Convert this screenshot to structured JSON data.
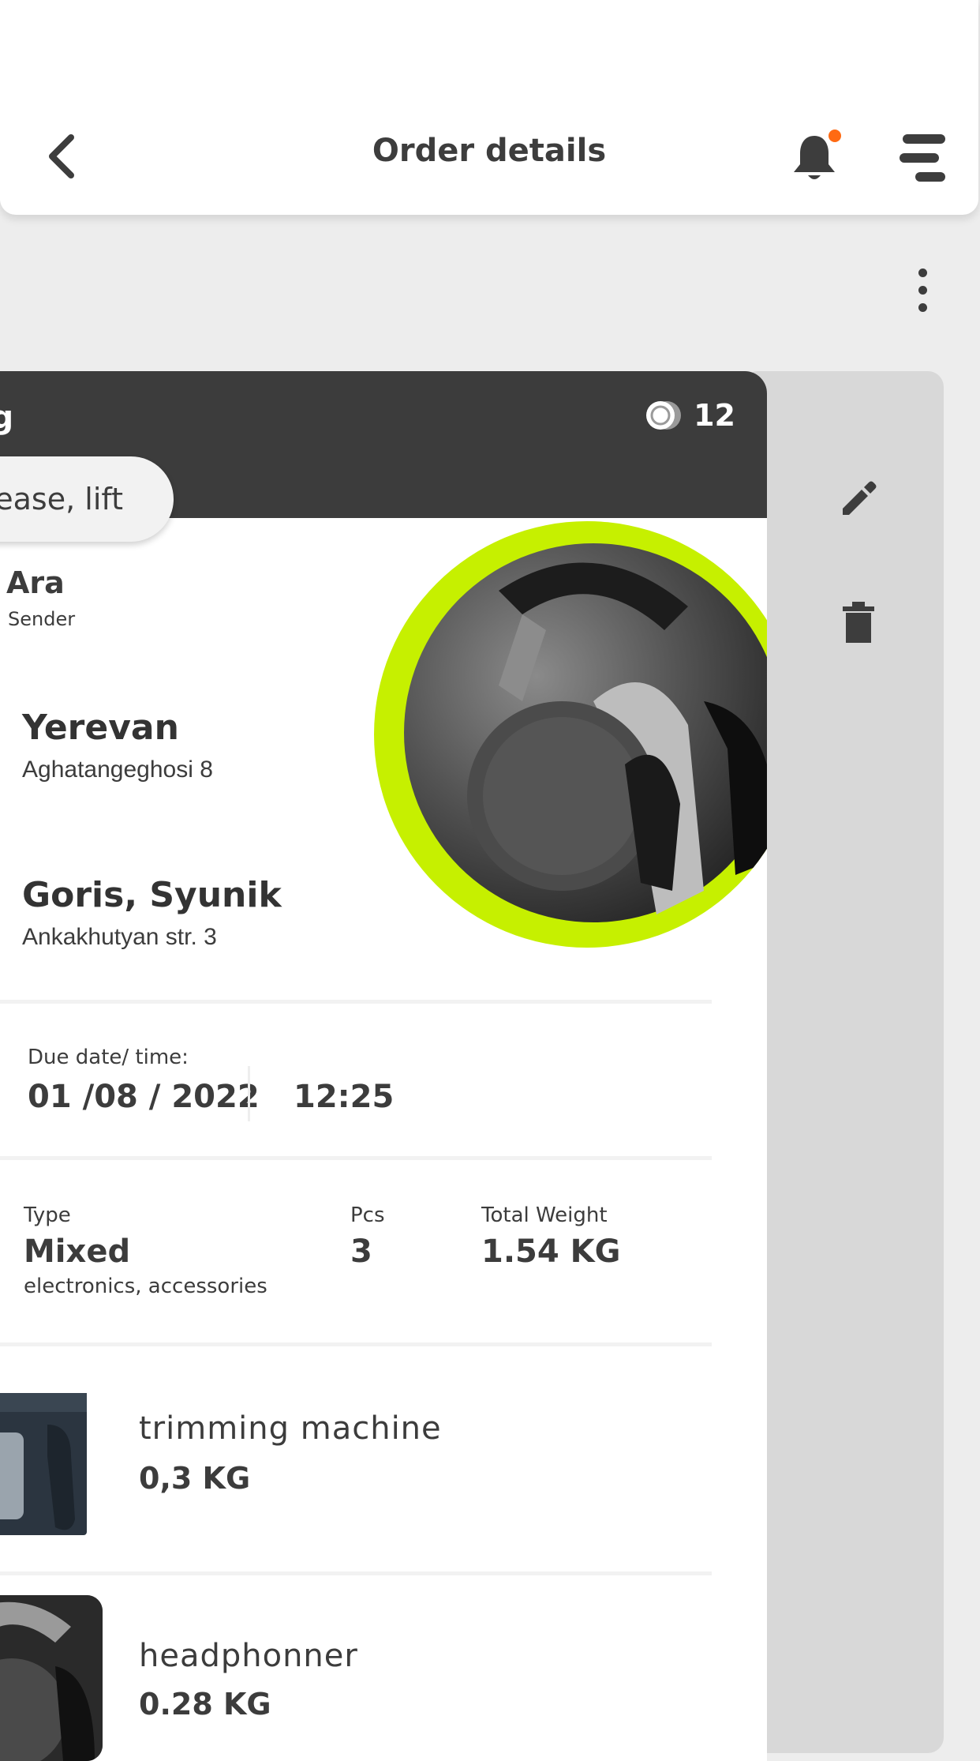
{
  "header": {
    "title": "Order details",
    "has_notification": true,
    "notification_dot_color": "#ff6a13"
  },
  "order": {
    "status_label": "ng",
    "coins": "12",
    "note_text": "ease, lift",
    "sender_name": "Ara",
    "sender_role": "Sender",
    "pickup": {
      "city": "Yerevan",
      "address": "Aghatangeghosi 8"
    },
    "dropoff": {
      "city": "Goris, Syunik",
      "address": "Ankakhutyan str. 3"
    },
    "due_label": "Due date/ time:",
    "due_date": "01 /08 / 2022",
    "due_time": "12:25",
    "type_label": "Type",
    "type_value": "Mixed",
    "type_detail": "electronics, accessories",
    "pcs_label": "Pcs",
    "pcs_value": "3",
    "weight_label": "Total Weight",
    "weight_value": "1.54 KG",
    "items": [
      {
        "name": "trimming machine",
        "weight": "0,3 KG"
      },
      {
        "name": "headphonner",
        "weight": "0.28 KG"
      }
    ]
  },
  "colors": {
    "accent": "#c6f000",
    "card_header": "#3c3c3c",
    "side_panel": "#d8d8d8"
  },
  "icons": {
    "back": "chevron-left-icon",
    "notification": "bell-icon",
    "menu": "menu-icon",
    "more": "more-vertical-icon",
    "edit": "pencil-icon",
    "delete": "trash-icon",
    "coins": "coin-icon"
  }
}
